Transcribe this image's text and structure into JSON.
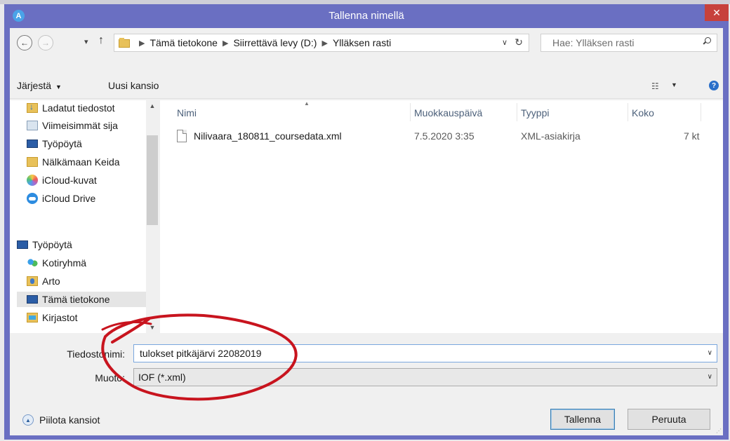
{
  "window": {
    "title": "Tallenna nimellä",
    "app_icon": "A",
    "close_label": "✕"
  },
  "address": {
    "crumbs": [
      "Tämä tietokone",
      "Siirrettävä levy (D:)",
      "Ylläksen rasti"
    ],
    "search_placeholder": "Hae: Ylläksen rasti"
  },
  "toolbar": {
    "organize": "Järjestä",
    "new_folder": "Uusi kansio"
  },
  "nav": {
    "items": [
      {
        "label": "Ladatut tiedostot",
        "icon": "downloads-folder-icon"
      },
      {
        "label": "Viimeisimmät sija",
        "icon": "recent-places-icon"
      },
      {
        "label": "Työpöytä",
        "icon": "desktop-icon"
      },
      {
        "label": "Nälkämaan Keida",
        "icon": "folder-icon"
      },
      {
        "label": "iCloud-kuvat",
        "icon": "icloud-photos-icon"
      },
      {
        "label": "iCloud Drive",
        "icon": "icloud-drive-icon"
      },
      {
        "label": "Työpöytä",
        "icon": "desktop-icon"
      },
      {
        "label": "Kotiryhmä",
        "icon": "homegroup-icon"
      },
      {
        "label": "Arto",
        "icon": "user-folder-icon"
      },
      {
        "label": "Tämä tietokone",
        "icon": "computer-icon"
      },
      {
        "label": "Kirjastot",
        "icon": "libraries-icon"
      }
    ],
    "selected_index": 9
  },
  "files": {
    "columns": [
      "Nimi",
      "Muokkauspäivä",
      "Tyyppi",
      "Koko"
    ],
    "rows": [
      {
        "name": "Nilivaara_180811_coursedata.xml",
        "modified": "7.5.2020 3:35",
        "type": "XML-asiakirja",
        "size": "7 kt"
      }
    ]
  },
  "form": {
    "filename_label": "Tiedostonimi:",
    "filename_value": "tulokset pitkäjärvi 22082019",
    "filetype_label": "Muoto:",
    "filetype_value": "IOF (*.xml)"
  },
  "footer": {
    "hide_folders": "Piilota kansiot",
    "save": "Tallenna",
    "cancel": "Peruuta"
  },
  "colors": {
    "title_bar": "#6a6fc2",
    "close_button": "#c7413c",
    "annotation": "#c8141e"
  }
}
